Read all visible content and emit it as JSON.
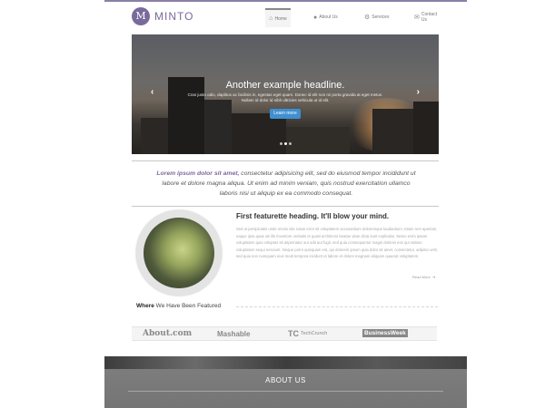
{
  "brand": {
    "badge": "M",
    "name": "MINTO",
    "accent": "#7a6a9c"
  },
  "nav": [
    {
      "label": "Home",
      "icon": "home-icon"
    },
    {
      "label": "About Us",
      "icon": "user-icon"
    },
    {
      "label": "Services",
      "icon": "gear-icon"
    },
    {
      "label": "Contact Us",
      "icon": "envelope-icon"
    }
  ],
  "hero": {
    "title": "Another example headline.",
    "subtitle": "Cras justo odio, dapibus ac facilisis in, egestas eget quam. Donec id elit non mi porta gravida at eget metus. Nullam id dolor id nibh ultricies vehicula ut id elit.",
    "button": "Learn more",
    "prev": "‹",
    "next": "›",
    "slides": 3,
    "active_slide": 2
  },
  "intro": {
    "lead": "Lorem ipsum dolor sit amet,",
    "text": " consectetur adipisicing elit, sed do eiusmod tempor incididunt ut labore et dolore magna aliqua. Ut enim ad minim veniam, quis nostrud exercitation ullamco laboris nisi ut aliquip ex ea commodo consequat."
  },
  "featurette": {
    "heading": "First featurette heading. It'll blow your mind.",
    "body": "Sed ut perspiciatis unde omnis iste natus error sit voluptatem accusantium doloremque laudantium, totam rem aperiam, eaque ipsa quae ab illo inventore veritatis et quasi architecto beatae vitae dicta sunt explicabo. Nemo enim ipsam voluptatem quia voluptas sit aspernatur aut odit aut fugit, sed quia consequuntur magni dolores eos qui ratione voluptatem sequi nesciunt. Neque porro quisquam est, qui dolorem ipsum quia dolor sit amet, consectetur, adipisci velit, sed quia non numquam eius modi tempora incidunt ut labore et dolore magnam aliquam quaerat voluptatem.",
    "read_more": "Read More"
  },
  "featured": {
    "label_bold": "Where",
    "label_rest": " We Have Been Featured",
    "logos": [
      "About.com",
      "Mashable",
      "TechCrunch",
      "BusinessWeek"
    ],
    "tc_mark": "TC"
  },
  "about": {
    "title": "ABOUT US"
  }
}
